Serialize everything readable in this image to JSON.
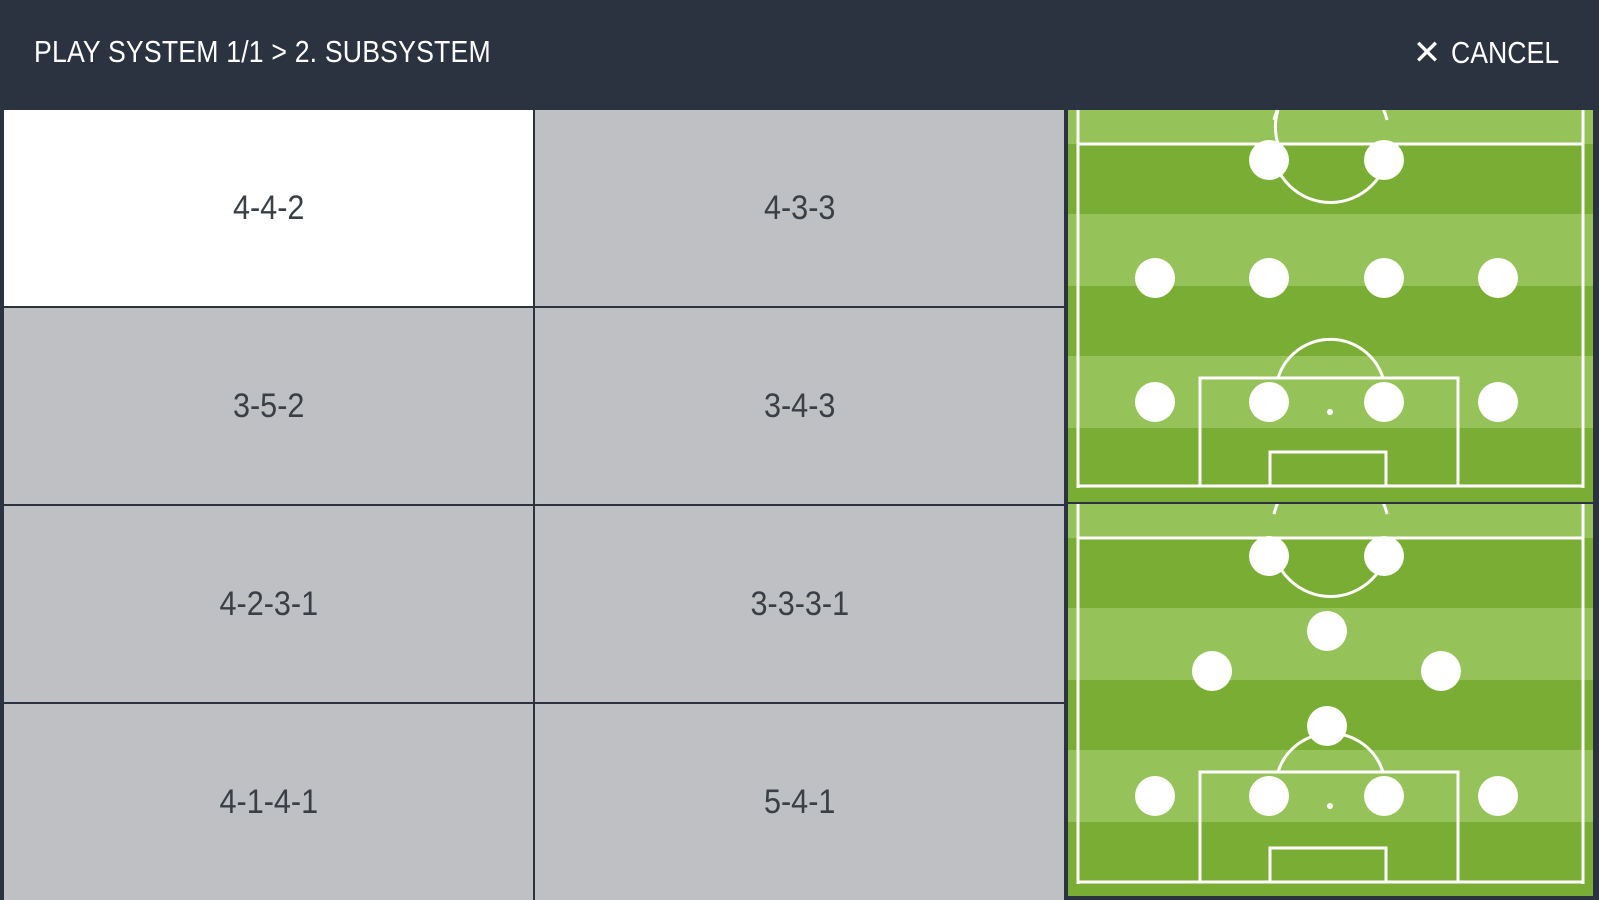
{
  "header": {
    "breadcrumb": "PLAY SYSTEM 1/1 > 2. SUBSYSTEM",
    "cancel_icon": "close-icon",
    "cancel_label": "CANCEL"
  },
  "systems": [
    {
      "label": "4-4-2",
      "selected": true
    },
    {
      "label": "4-3-3",
      "selected": false
    },
    {
      "label": "3-5-2",
      "selected": false
    },
    {
      "label": "3-4-3",
      "selected": false
    },
    {
      "label": "4-2-3-1",
      "selected": false
    },
    {
      "label": "3-3-3-1",
      "selected": false
    },
    {
      "label": "4-1-4-1",
      "selected": false
    },
    {
      "label": "5-4-1",
      "selected": false
    }
  ],
  "colors": {
    "header_bg": "#2b3340",
    "option_bg": "#bfc0c3",
    "option_selected_bg": "#ffffff",
    "pitch_dark": "#7aad34",
    "pitch_light": "#96c25a"
  }
}
